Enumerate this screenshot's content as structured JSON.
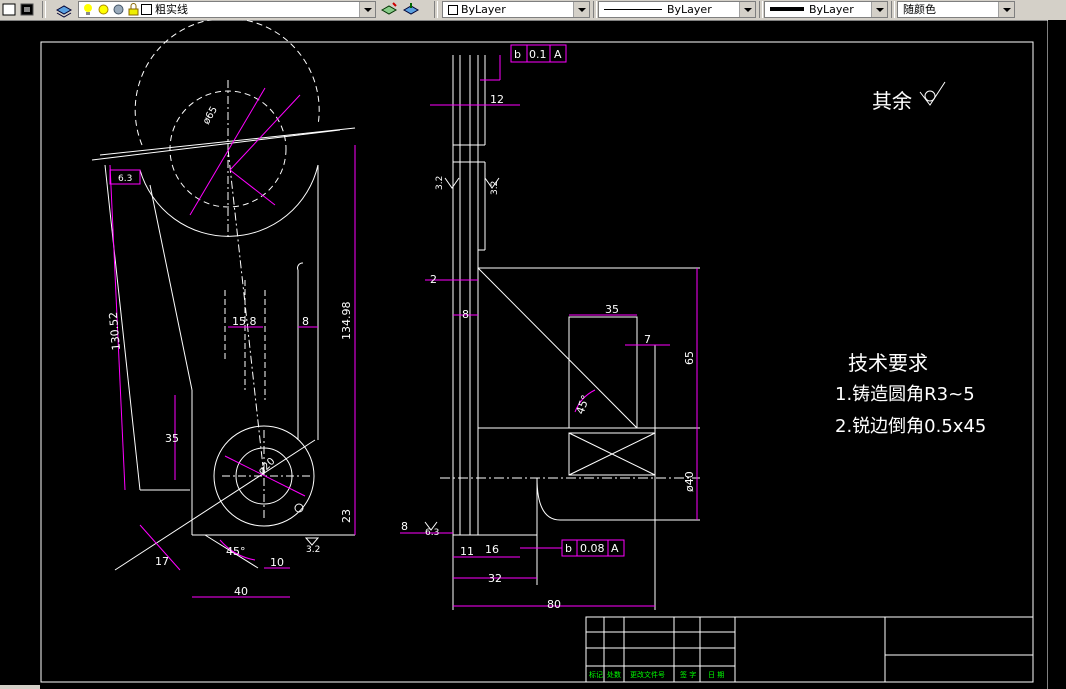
{
  "toolbar": {
    "layer_name": "粗实线",
    "color_combo": "ByLayer",
    "linetype_combo": "ByLayer",
    "lineweight_combo": "ByLayer",
    "plotstyle_combo": "随颜色"
  },
  "drawing": {
    "roughness_other": "其余",
    "tech_title": "技术要求",
    "tech_items": [
      "1.铸造圆角R3~5",
      "2.锐边倒角0.5x45"
    ],
    "tolerance_top": {
      "symbol": "b",
      "value": "0.1",
      "datum": "A"
    },
    "tolerance_bottom": {
      "symbol": "b",
      "value": "0.08",
      "datum": "A"
    },
    "dimensions": {
      "d_12": "12",
      "d_2": "2",
      "d_8a": "8",
      "d_35a": "35",
      "d_7": "7",
      "d_65": "65",
      "d_40dia": "ø40",
      "d_8b": "8",
      "d_11": "11",
      "d_16": "16",
      "d_32": "32",
      "d_80": "80",
      "d_15_8": "15.8",
      "d_8c": "8",
      "d_134_98": "134.98",
      "d_130_52": "130.52",
      "d_35b": "35",
      "d_23": "23",
      "d_10": "10",
      "d_40": "40",
      "d_17": "17",
      "angle_45a": "45°",
      "angle_45b": "45°",
      "rough_3_2a": "3.2",
      "rough_3_2b": "3.2",
      "rough_6_3": "6.3",
      "rough_3_2c": "3.2",
      "rough_6_3b": "6.3",
      "dia_small": "ø20",
      "r_top": "ø65"
    },
    "title_block_cells": [
      "标记",
      "处数",
      "更改文件号",
      "签 字",
      "日 期"
    ]
  },
  "colors": {
    "background": "#000000",
    "geometry": "#ffffff",
    "dimension": "#ff00ff",
    "text_green": "#00ff00"
  }
}
